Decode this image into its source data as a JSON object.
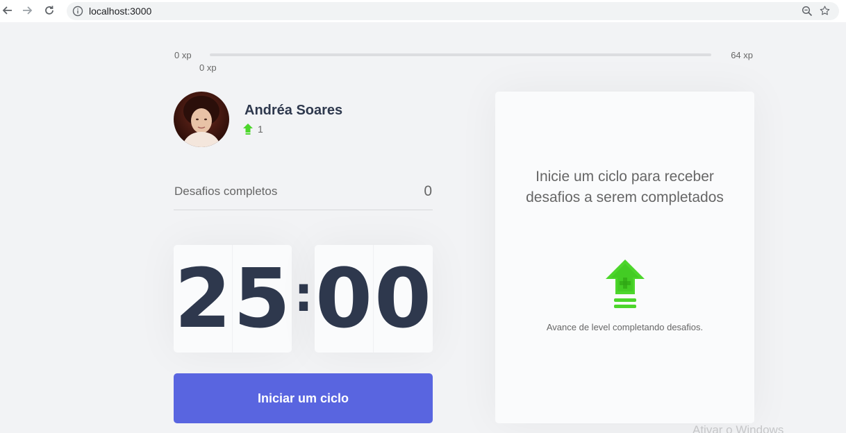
{
  "browser": {
    "url": "localhost:3000"
  },
  "xp": {
    "start_label": "0 xp",
    "end_label": "64 xp",
    "current_label": "0 xp",
    "progress_fraction": 0
  },
  "profile": {
    "name": "Andréa Soares",
    "level": "1"
  },
  "challenges": {
    "label": "Desafios completos",
    "count": "0"
  },
  "countdown": {
    "minute_left": "2",
    "minute_right": "5",
    "separator": ":",
    "second_left": "0",
    "second_right": "0"
  },
  "start_button": {
    "label": "Iniciar um ciclo"
  },
  "challenge_box": {
    "title": "Inicie um ciclo para receber desafios a serem completados",
    "hint": "Avance de level completando desafios."
  },
  "watermark": {
    "text": "Ativar o Windows"
  },
  "colors": {
    "accent_blue": "#5965e0",
    "level_green": "#4cd62b",
    "title_text": "#2e384d",
    "body_text": "#666666",
    "background": "#f2f3f5"
  }
}
